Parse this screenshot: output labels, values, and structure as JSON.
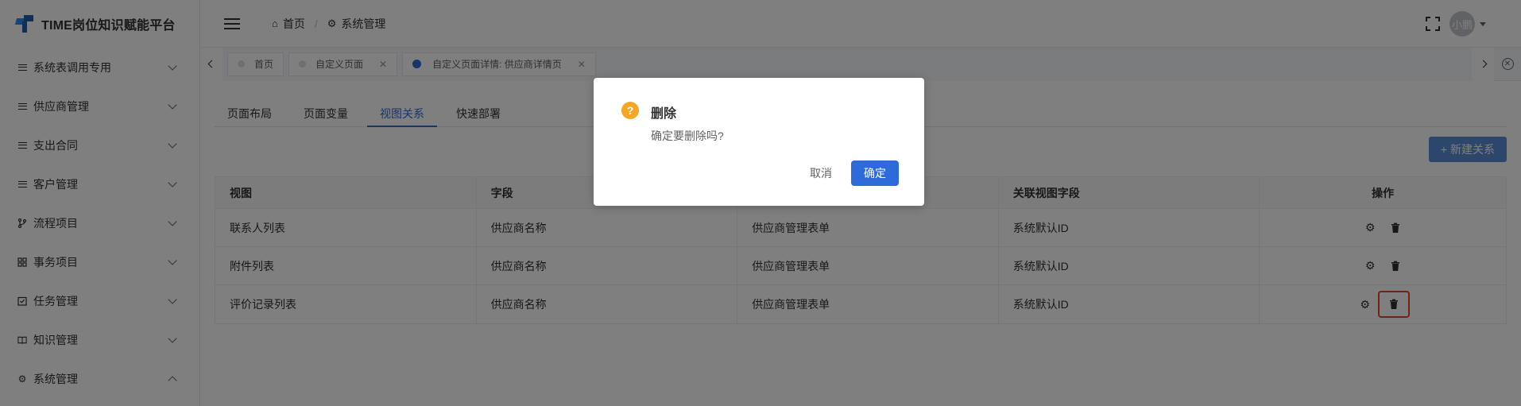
{
  "app": {
    "title": "TIME岗位知识赋能平台"
  },
  "sidebar": {
    "items": [
      {
        "label": "系统表调用专用",
        "icon": "list-icon",
        "expanded": false
      },
      {
        "label": "供应商管理",
        "icon": "list-icon",
        "expanded": false
      },
      {
        "label": "支出合同",
        "icon": "list-icon",
        "expanded": false
      },
      {
        "label": "客户管理",
        "icon": "list-icon",
        "expanded": false
      },
      {
        "label": "流程项目",
        "icon": "branch-icon",
        "expanded": false
      },
      {
        "label": "事务项目",
        "icon": "grid-icon",
        "expanded": false
      },
      {
        "label": "任务管理",
        "icon": "checkbox-icon",
        "expanded": false
      },
      {
        "label": "知识管理",
        "icon": "book-icon",
        "expanded": false
      },
      {
        "label": "系统管理",
        "icon": "gear-icon",
        "expanded": true
      }
    ]
  },
  "header": {
    "breadcrumb": [
      {
        "label": "首页",
        "icon": "home-icon"
      },
      {
        "label": "系统管理",
        "icon": "gear-icon"
      }
    ],
    "avatar_text": "小鹏"
  },
  "tags": [
    {
      "label": "首页",
      "active": false,
      "closable": false
    },
    {
      "label": "自定义页面",
      "active": false,
      "closable": true
    },
    {
      "label": "自定义页面详情: 供应商详情页",
      "active": true,
      "closable": true
    }
  ],
  "subtabs": [
    {
      "label": "页面布局",
      "active": false
    },
    {
      "label": "页面变量",
      "active": false
    },
    {
      "label": "视图关系",
      "active": true
    },
    {
      "label": "快速部署",
      "active": false
    }
  ],
  "new_button": "+ 新建关系",
  "table": {
    "headers": [
      "视图",
      "字段",
      "",
      "关联视图字段",
      "操作"
    ],
    "rows": [
      [
        "联系人列表",
        "供应商名称",
        "供应商管理表单",
        "系统默认ID"
      ],
      [
        "附件列表",
        "供应商名称",
        "供应商管理表单",
        "系统默认ID"
      ],
      [
        "评价记录列表",
        "供应商名称",
        "供应商管理表单",
        "系统默认ID"
      ]
    ]
  },
  "dialog": {
    "title": "删除",
    "message": "确定要删除吗?",
    "cancel": "取消",
    "confirm": "确定",
    "icon_glyph": "?"
  }
}
